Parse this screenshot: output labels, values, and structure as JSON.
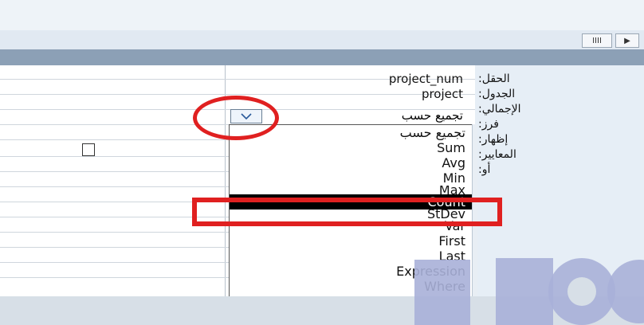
{
  "labels": {
    "field": "الحقل:",
    "table": "الجدول:",
    "total": "الإجمالي:",
    "sort": "فرز:",
    "show": "إظهار:",
    "criteria": "المعايير:",
    "or": "أو:"
  },
  "column": {
    "field_value": "project_num",
    "table_value": "project",
    "total_value": "تجميع حسب"
  },
  "dropdown": {
    "options": [
      "تجميع حسب",
      "Sum",
      "Avg",
      "Min",
      "Max",
      "Count",
      "StDev",
      "Var",
      "First",
      "Last",
      "Expression",
      "Where"
    ],
    "selected": "Count"
  },
  "scrollbar": {
    "thumb_glyph": "IIII",
    "arrow_glyph": "▶"
  },
  "colors": {
    "highlight_red": "#e02020",
    "selected_bg": "#000000",
    "watermark": "#a8b0d8"
  }
}
